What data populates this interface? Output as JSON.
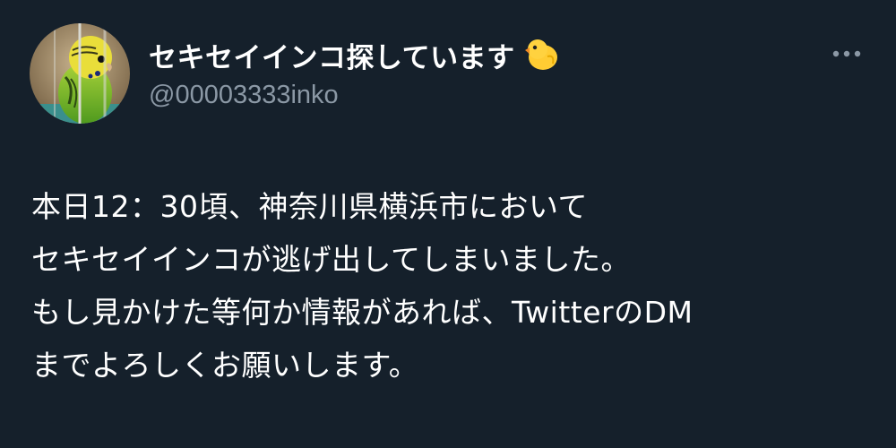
{
  "profile": {
    "display_name": "セキセイインコ探しています",
    "name_emoji_icon": "chick-icon",
    "handle": "@00003333inko",
    "avatar_icon": "budgerigar-photo"
  },
  "menu": {
    "icon": "more-horizontal-icon"
  },
  "tweet": {
    "lines": [
      "本日12：30頃、神奈川県横浜市において",
      "セキセイインコが逃げ出してしまいました。",
      "もし見かけた等何か情報があれば、TwitterのDM",
      "までよろしくお願いします。"
    ]
  },
  "colors": {
    "background": "#15202b",
    "primary_text": "#ffffff",
    "secondary_text": "#8b98a5"
  }
}
